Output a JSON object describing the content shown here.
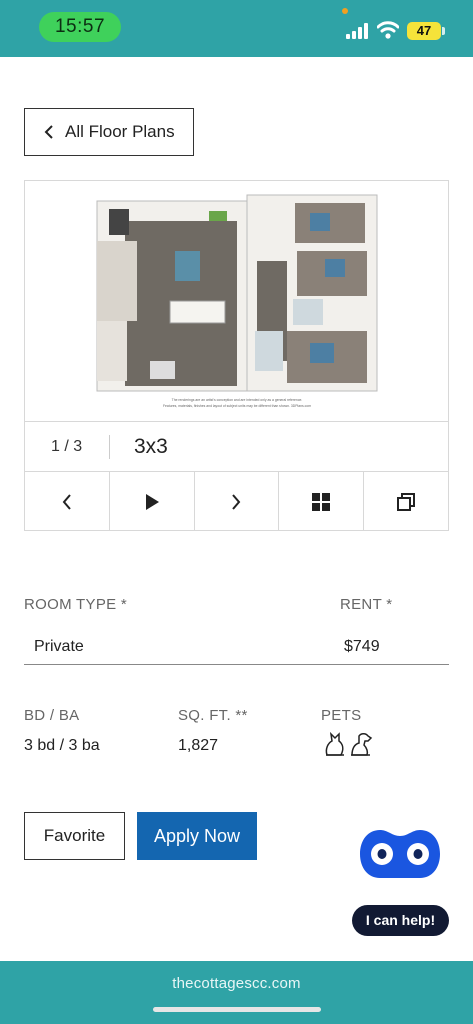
{
  "status_bar": {
    "time": "15:57",
    "battery": "47",
    "colors": {
      "bar": "#2fa3a6",
      "time_pill": "#3fd15b",
      "battery": "#f5e33a"
    }
  },
  "nav": {
    "back_label": "All Floor Plans"
  },
  "gallery": {
    "counter": "1 / 3",
    "plan_name": "3x3",
    "disclaimer_line1": "The renderings are an artist's conception and are intended only as a general reference.",
    "disclaimer_line2": "Features, materials, finishes and layout of subject units may be different than shown. 3DPlans.com",
    "controls": [
      "chevron-left-icon",
      "play-icon",
      "chevron-right-icon",
      "grid-icon",
      "copy-icon"
    ]
  },
  "details": {
    "room_type_label": "ROOM TYPE *",
    "room_type_value": "Private",
    "rent_label": "RENT *",
    "rent_value": "$749",
    "bdba_label": "BD / BA",
    "bdba_value": "3 bd / 3 ba",
    "sqft_label": "SQ. FT. **",
    "sqft_value": "1,827",
    "pets_label": "PETS",
    "pets_icons": [
      "cat-icon",
      "dog-icon"
    ]
  },
  "actions": {
    "favorite_label": "Favorite",
    "apply_label": "Apply Now",
    "apply_color": "#1466b0"
  },
  "chat": {
    "help_label": "I can help!",
    "bot_color": "#1a56e0"
  },
  "footer": {
    "domain": "thecottagescc.com"
  }
}
